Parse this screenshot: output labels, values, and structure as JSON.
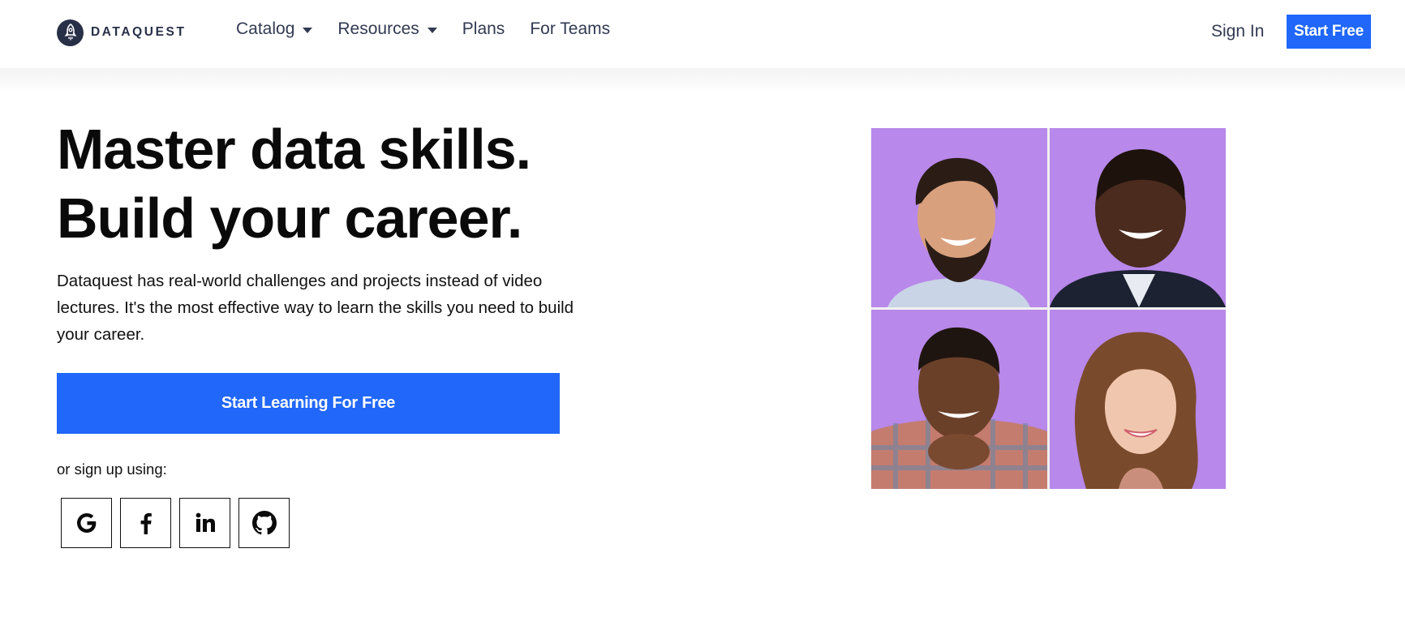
{
  "header": {
    "logo_text": "DATAQUEST",
    "nav": [
      {
        "label": "Catalog",
        "has_dropdown": true
      },
      {
        "label": "Resources",
        "has_dropdown": true
      },
      {
        "label": "Plans",
        "has_dropdown": false
      },
      {
        "label": "For Teams",
        "has_dropdown": false
      }
    ],
    "sign_in": "Sign In",
    "start_free": "Start Free"
  },
  "hero": {
    "title_line1": "Master data skills.",
    "title_line2": "Build your career.",
    "description": "Dataquest has real-world challenges and projects instead of video lectures. It's the most effective way to learn the skills you need to build your career.",
    "cta": "Start Learning For Free",
    "or_text": "or sign up using:",
    "socials": [
      {
        "name": "google",
        "icon": "google-icon"
      },
      {
        "name": "facebook",
        "icon": "facebook-icon"
      },
      {
        "name": "linkedin",
        "icon": "linkedin-icon"
      },
      {
        "name": "github",
        "icon": "github-icon"
      }
    ]
  },
  "photos": [
    {
      "description": "Smiling young man with dark hair and beard"
    },
    {
      "description": "Smiling man in dark suit"
    },
    {
      "description": "Smiling man in plaid shirt resting chin on hands"
    },
    {
      "description": "Smiling woman with wavy auburn hair"
    }
  ],
  "colors": {
    "brand_blue": "#2067fa",
    "navy": "#283048",
    "photo_bg": "#b888ea"
  }
}
